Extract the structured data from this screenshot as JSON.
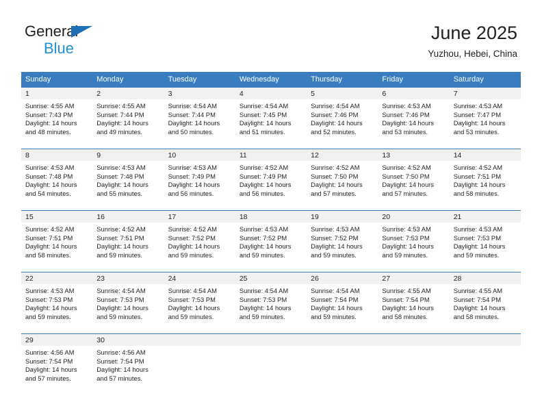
{
  "brand": {
    "name_part1": "General",
    "name_part2": "Blue",
    "triangle_color": "#1f6fb5",
    "blue_text_color": "#1f8fd8"
  },
  "header": {
    "title": "June 2025",
    "subtitle": "Yuzhou, Hebei, China"
  },
  "theme": {
    "header_bar_color": "#3a7cc0",
    "daynum_band_color": "#f1f1f1",
    "text_color": "#231f20"
  },
  "calendar": {
    "day_names": [
      "Sunday",
      "Monday",
      "Tuesday",
      "Wednesday",
      "Thursday",
      "Friday",
      "Saturday"
    ],
    "weeks": [
      [
        {
          "day": "1",
          "sunrise": "Sunrise: 4:55 AM",
          "sunset": "Sunset: 7:43 PM",
          "daylight_line1": "Daylight: 14 hours",
          "daylight_line2": "and 48 minutes."
        },
        {
          "day": "2",
          "sunrise": "Sunrise: 4:55 AM",
          "sunset": "Sunset: 7:44 PM",
          "daylight_line1": "Daylight: 14 hours",
          "daylight_line2": "and 49 minutes."
        },
        {
          "day": "3",
          "sunrise": "Sunrise: 4:54 AM",
          "sunset": "Sunset: 7:44 PM",
          "daylight_line1": "Daylight: 14 hours",
          "daylight_line2": "and 50 minutes."
        },
        {
          "day": "4",
          "sunrise": "Sunrise: 4:54 AM",
          "sunset": "Sunset: 7:45 PM",
          "daylight_line1": "Daylight: 14 hours",
          "daylight_line2": "and 51 minutes."
        },
        {
          "day": "5",
          "sunrise": "Sunrise: 4:54 AM",
          "sunset": "Sunset: 7:46 PM",
          "daylight_line1": "Daylight: 14 hours",
          "daylight_line2": "and 52 minutes."
        },
        {
          "day": "6",
          "sunrise": "Sunrise: 4:53 AM",
          "sunset": "Sunset: 7:46 PM",
          "daylight_line1": "Daylight: 14 hours",
          "daylight_line2": "and 53 minutes."
        },
        {
          "day": "7",
          "sunrise": "Sunrise: 4:53 AM",
          "sunset": "Sunset: 7:47 PM",
          "daylight_line1": "Daylight: 14 hours",
          "daylight_line2": "and 53 minutes."
        }
      ],
      [
        {
          "day": "8",
          "sunrise": "Sunrise: 4:53 AM",
          "sunset": "Sunset: 7:48 PM",
          "daylight_line1": "Daylight: 14 hours",
          "daylight_line2": "and 54 minutes."
        },
        {
          "day": "9",
          "sunrise": "Sunrise: 4:53 AM",
          "sunset": "Sunset: 7:48 PM",
          "daylight_line1": "Daylight: 14 hours",
          "daylight_line2": "and 55 minutes."
        },
        {
          "day": "10",
          "sunrise": "Sunrise: 4:53 AM",
          "sunset": "Sunset: 7:49 PM",
          "daylight_line1": "Daylight: 14 hours",
          "daylight_line2": "and 56 minutes."
        },
        {
          "day": "11",
          "sunrise": "Sunrise: 4:52 AM",
          "sunset": "Sunset: 7:49 PM",
          "daylight_line1": "Daylight: 14 hours",
          "daylight_line2": "and 56 minutes."
        },
        {
          "day": "12",
          "sunrise": "Sunrise: 4:52 AM",
          "sunset": "Sunset: 7:50 PM",
          "daylight_line1": "Daylight: 14 hours",
          "daylight_line2": "and 57 minutes."
        },
        {
          "day": "13",
          "sunrise": "Sunrise: 4:52 AM",
          "sunset": "Sunset: 7:50 PM",
          "daylight_line1": "Daylight: 14 hours",
          "daylight_line2": "and 57 minutes."
        },
        {
          "day": "14",
          "sunrise": "Sunrise: 4:52 AM",
          "sunset": "Sunset: 7:51 PM",
          "daylight_line1": "Daylight: 14 hours",
          "daylight_line2": "and 58 minutes."
        }
      ],
      [
        {
          "day": "15",
          "sunrise": "Sunrise: 4:52 AM",
          "sunset": "Sunset: 7:51 PM",
          "daylight_line1": "Daylight: 14 hours",
          "daylight_line2": "and 58 minutes."
        },
        {
          "day": "16",
          "sunrise": "Sunrise: 4:52 AM",
          "sunset": "Sunset: 7:51 PM",
          "daylight_line1": "Daylight: 14 hours",
          "daylight_line2": "and 59 minutes."
        },
        {
          "day": "17",
          "sunrise": "Sunrise: 4:52 AM",
          "sunset": "Sunset: 7:52 PM",
          "daylight_line1": "Daylight: 14 hours",
          "daylight_line2": "and 59 minutes."
        },
        {
          "day": "18",
          "sunrise": "Sunrise: 4:53 AM",
          "sunset": "Sunset: 7:52 PM",
          "daylight_line1": "Daylight: 14 hours",
          "daylight_line2": "and 59 minutes."
        },
        {
          "day": "19",
          "sunrise": "Sunrise: 4:53 AM",
          "sunset": "Sunset: 7:52 PM",
          "daylight_line1": "Daylight: 14 hours",
          "daylight_line2": "and 59 minutes."
        },
        {
          "day": "20",
          "sunrise": "Sunrise: 4:53 AM",
          "sunset": "Sunset: 7:53 PM",
          "daylight_line1": "Daylight: 14 hours",
          "daylight_line2": "and 59 minutes."
        },
        {
          "day": "21",
          "sunrise": "Sunrise: 4:53 AM",
          "sunset": "Sunset: 7:53 PM",
          "daylight_line1": "Daylight: 14 hours",
          "daylight_line2": "and 59 minutes."
        }
      ],
      [
        {
          "day": "22",
          "sunrise": "Sunrise: 4:53 AM",
          "sunset": "Sunset: 7:53 PM",
          "daylight_line1": "Daylight: 14 hours",
          "daylight_line2": "and 59 minutes."
        },
        {
          "day": "23",
          "sunrise": "Sunrise: 4:54 AM",
          "sunset": "Sunset: 7:53 PM",
          "daylight_line1": "Daylight: 14 hours",
          "daylight_line2": "and 59 minutes."
        },
        {
          "day": "24",
          "sunrise": "Sunrise: 4:54 AM",
          "sunset": "Sunset: 7:53 PM",
          "daylight_line1": "Daylight: 14 hours",
          "daylight_line2": "and 59 minutes."
        },
        {
          "day": "25",
          "sunrise": "Sunrise: 4:54 AM",
          "sunset": "Sunset: 7:53 PM",
          "daylight_line1": "Daylight: 14 hours",
          "daylight_line2": "and 59 minutes."
        },
        {
          "day": "26",
          "sunrise": "Sunrise: 4:54 AM",
          "sunset": "Sunset: 7:54 PM",
          "daylight_line1": "Daylight: 14 hours",
          "daylight_line2": "and 59 minutes."
        },
        {
          "day": "27",
          "sunrise": "Sunrise: 4:55 AM",
          "sunset": "Sunset: 7:54 PM",
          "daylight_line1": "Daylight: 14 hours",
          "daylight_line2": "and 58 minutes."
        },
        {
          "day": "28",
          "sunrise": "Sunrise: 4:55 AM",
          "sunset": "Sunset: 7:54 PM",
          "daylight_line1": "Daylight: 14 hours",
          "daylight_line2": "and 58 minutes."
        }
      ],
      [
        {
          "day": "29",
          "sunrise": "Sunrise: 4:56 AM",
          "sunset": "Sunset: 7:54 PM",
          "daylight_line1": "Daylight: 14 hours",
          "daylight_line2": "and 57 minutes."
        },
        {
          "day": "30",
          "sunrise": "Sunrise: 4:56 AM",
          "sunset": "Sunset: 7:54 PM",
          "daylight_line1": "Daylight: 14 hours",
          "daylight_line2": "and 57 minutes."
        },
        {
          "day": "",
          "sunrise": "",
          "sunset": "",
          "daylight_line1": "",
          "daylight_line2": ""
        },
        {
          "day": "",
          "sunrise": "",
          "sunset": "",
          "daylight_line1": "",
          "daylight_line2": ""
        },
        {
          "day": "",
          "sunrise": "",
          "sunset": "",
          "daylight_line1": "",
          "daylight_line2": ""
        },
        {
          "day": "",
          "sunrise": "",
          "sunset": "",
          "daylight_line1": "",
          "daylight_line2": ""
        },
        {
          "day": "",
          "sunrise": "",
          "sunset": "",
          "daylight_line1": "",
          "daylight_line2": ""
        }
      ]
    ]
  }
}
